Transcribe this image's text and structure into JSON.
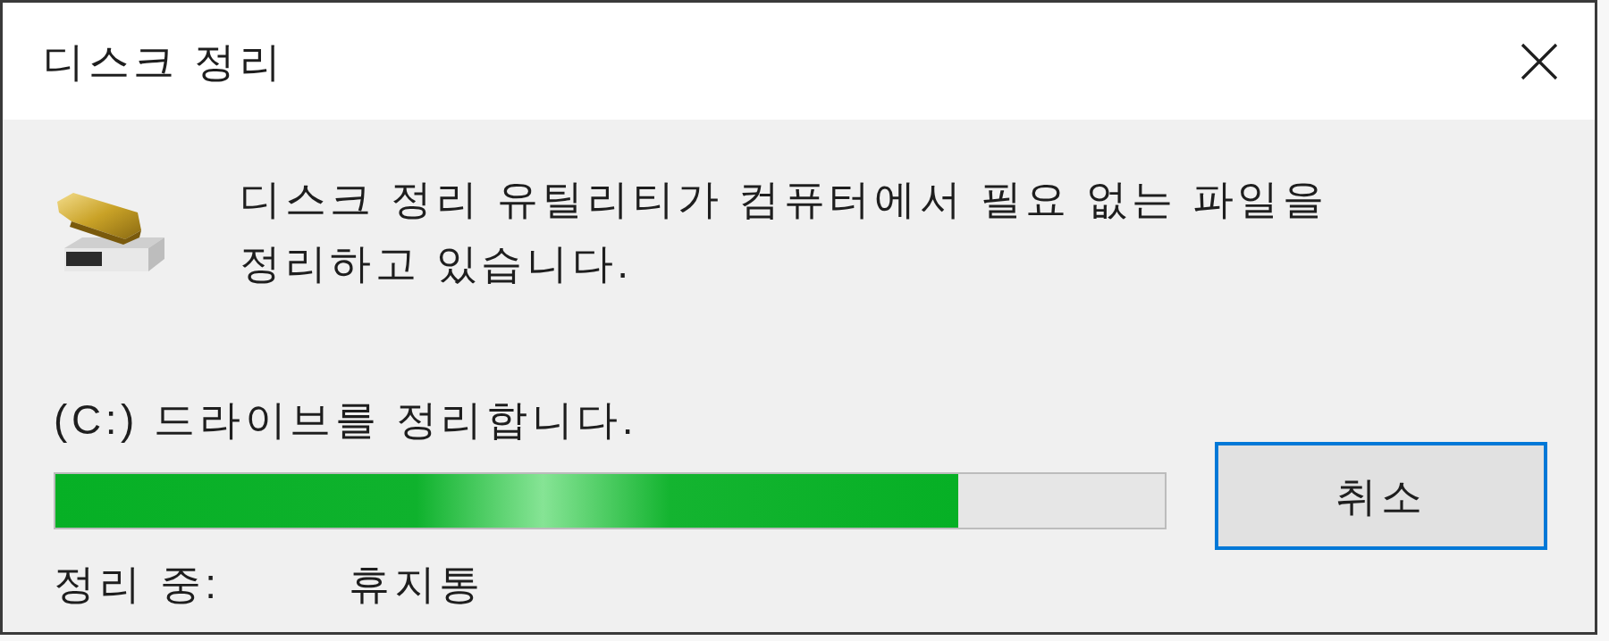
{
  "window": {
    "title": "디스크 정리"
  },
  "message": "디스크 정리 유틸리티가 컴퓨터에서 필요 없는 파일을 정리하고 있습니다.",
  "status": "(C:) 드라이브를 정리합니다.",
  "progress": {
    "level": 0.814
  },
  "current": {
    "label": "정리 중:",
    "value": "휴지통"
  },
  "buttons": [
    {
      "label": "취소",
      "focused": true
    }
  ]
}
